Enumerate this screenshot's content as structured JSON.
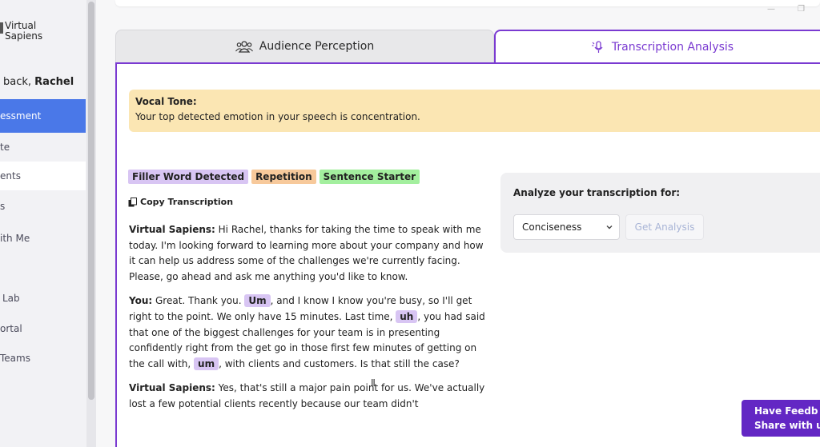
{
  "sidebar": {
    "brand_line1": "Virtual",
    "brand_line2": "Sapiens",
    "welcome_prefix": "back,",
    "welcome_name": "Rachel",
    "items": [
      {
        "label": "essment"
      },
      {
        "label": "te"
      },
      {
        "label": "ents"
      },
      {
        "label": "s"
      },
      {
        "label": "ith Me"
      },
      {
        "label": "Lab"
      },
      {
        "label": "ortal"
      },
      {
        "label": "Teams"
      }
    ]
  },
  "tabs": {
    "audience": "Audience Perception",
    "transcription": "Transcription Analysis"
  },
  "vocal": {
    "title": "Vocal Tone:",
    "text": "Your top detected emotion in your speech is concentration."
  },
  "legend": {
    "filler": "Filler Word Detected",
    "repetition": "Repetition",
    "starter": "Sentence Starter"
  },
  "copy_label": "Copy Transcription",
  "transcript": {
    "p1_speaker": "Virtual Sapiens:",
    "p1_text": " Hi Rachel, thanks for taking the time to speak with me today. I'm looking forward to learning more about your company and how it can help us address some of the challenges we're currently facing. Please, go ahead and ask me anything you'd like to know.",
    "p2_speaker": "You:",
    "p2_a": " Great. Thank you. ",
    "p2_f1": "Um",
    "p2_b": ", and I know I know you're busy, so I'll get right to the point. We only have 15 minutes. Last time, ",
    "p2_f2": "uh",
    "p2_c": ", you had said that one of the biggest challenges for your team is in presenting confidently right from the get go in those first few minutes of getting on the call with, ",
    "p2_f3": "um",
    "p2_d": ", with clients and customers. Is that still the case?",
    "p3_speaker": "Virtual Sapiens:",
    "p3_text": " Yes, that's still a major pain point for us. We've actually lost a few potential clients recently because our team didn't"
  },
  "analyze": {
    "title": "Analyze your transcription for:",
    "selected": "Conciseness",
    "button": "Get Analysis"
  },
  "feedback": {
    "line1": "Have Feedb",
    "line2": "Share with u"
  },
  "colors": {
    "accent": "#7a3ad1",
    "nav_active": "#4a78e8",
    "vocal_bg": "#fbe6b3",
    "filler": "#d8c5f3",
    "repetition": "#f7c99b",
    "starter": "#a3ef9e",
    "feedback_bg": "#6327c4"
  }
}
